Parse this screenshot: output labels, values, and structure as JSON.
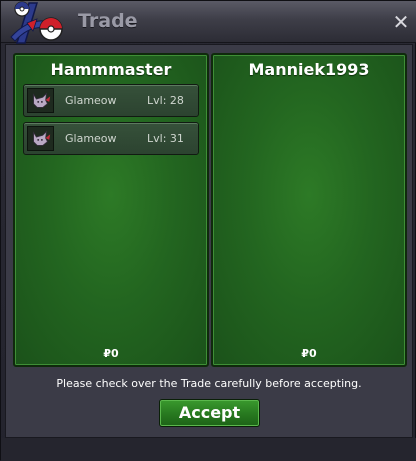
{
  "window": {
    "title": "Trade",
    "close_label": "✕"
  },
  "left_panel": {
    "name": "Hammmaster",
    "money": "₽0",
    "items": [
      {
        "name": "Glameow",
        "level": "Lvl: 28"
      },
      {
        "name": "Glameow",
        "level": "Lvl: 31"
      }
    ]
  },
  "right_panel": {
    "name": "Manniek1993",
    "money": "₽0"
  },
  "notice": "Please check over the Trade carefully before accepting.",
  "accept_label": "Accept",
  "colors": {
    "panel_green": "#236620",
    "accept_green": "#27781f"
  }
}
